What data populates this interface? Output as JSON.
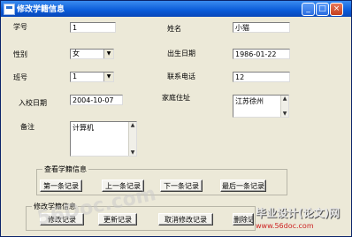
{
  "window": {
    "title": "修改学籍信息"
  },
  "form": {
    "xuehao": {
      "label": "学号",
      "value": "1"
    },
    "xingming": {
      "label": "姓名",
      "value": "小猫"
    },
    "xingbie": {
      "label": "性别",
      "value": "女"
    },
    "chusheng": {
      "label": "出生日期",
      "value": "1986-01-22"
    },
    "banhao": {
      "label": "班号",
      "value": "1"
    },
    "dianhua": {
      "label": "联系电话",
      "value": "12"
    },
    "ruxiao": {
      "label": "入校日期",
      "value": "2004-10-07"
    },
    "dizhi": {
      "label": "家庭住址",
      "value": "江苏徐州"
    },
    "beizhu": {
      "label": "备注",
      "value": "计算机"
    }
  },
  "browse": {
    "caption": "查看学籍信息",
    "first": "第一条记录",
    "prev": "上一条记录",
    "next": "下一条记录",
    "last": "最后一条记录"
  },
  "edit": {
    "caption": "修改学籍信息",
    "modify": "修改记录",
    "update": "更新记录",
    "cancel": "取消修改记录",
    "delete": "删除记录"
  },
  "watermark": {
    "main": "56Doc.com",
    "badge_title": "毕业设计(论文)网",
    "badge_url": "www.56doc.com"
  }
}
